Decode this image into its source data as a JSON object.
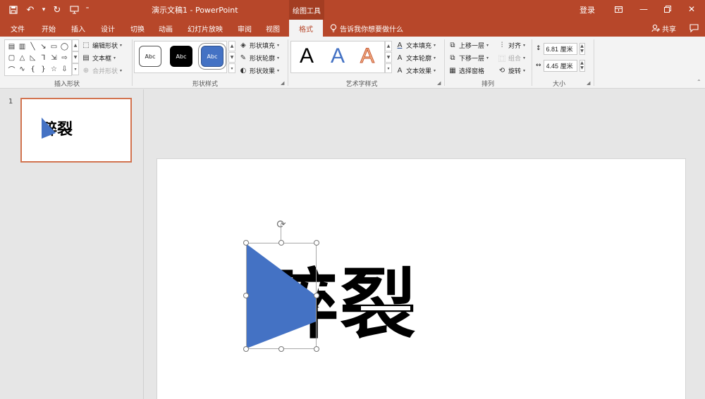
{
  "app": {
    "doc_title": "演示文稿1  -  PowerPoint",
    "contextual_tools": "绘图工具",
    "login": "登录"
  },
  "tabs": [
    "文件",
    "开始",
    "插入",
    "设计",
    "切换",
    "动画",
    "幻灯片放映",
    "审阅",
    "视图",
    "格式"
  ],
  "active_tab": "格式",
  "tell_me": "告诉我你想要做什么",
  "share": "共享",
  "groups": {
    "insert_shapes": {
      "label": "插入形状",
      "edit_shape": "编辑形状",
      "text_box": "文本框",
      "merge_shapes": "合并形状"
    },
    "shape_styles": {
      "label": "形状样式",
      "swatches": [
        "Abc",
        "Abc",
        "Abc"
      ],
      "fill": "形状填充",
      "outline": "形状轮廓",
      "effects": "形状效果"
    },
    "wordart": {
      "label": "艺术字样式",
      "letters": [
        "A",
        "A",
        "A"
      ],
      "text_fill": "文本填充",
      "text_outline": "文本轮廓",
      "text_effects": "文本效果"
    },
    "arrange": {
      "label": "排列",
      "bring_forward": "上移一层",
      "send_backward": "下移一层",
      "selection_pane": "选择窗格",
      "align": "对齐",
      "group": "组合",
      "rotate": "旋转"
    },
    "size": {
      "label": "大小",
      "height": "6.81 厘米",
      "width": "4.45 厘米"
    }
  },
  "slides": {
    "thumbnail_number": "1",
    "text": "碎裂"
  },
  "colors": {
    "accent": "#b7472a",
    "shape_fill": "#4472c4",
    "thumb_border": "#d2734f"
  }
}
